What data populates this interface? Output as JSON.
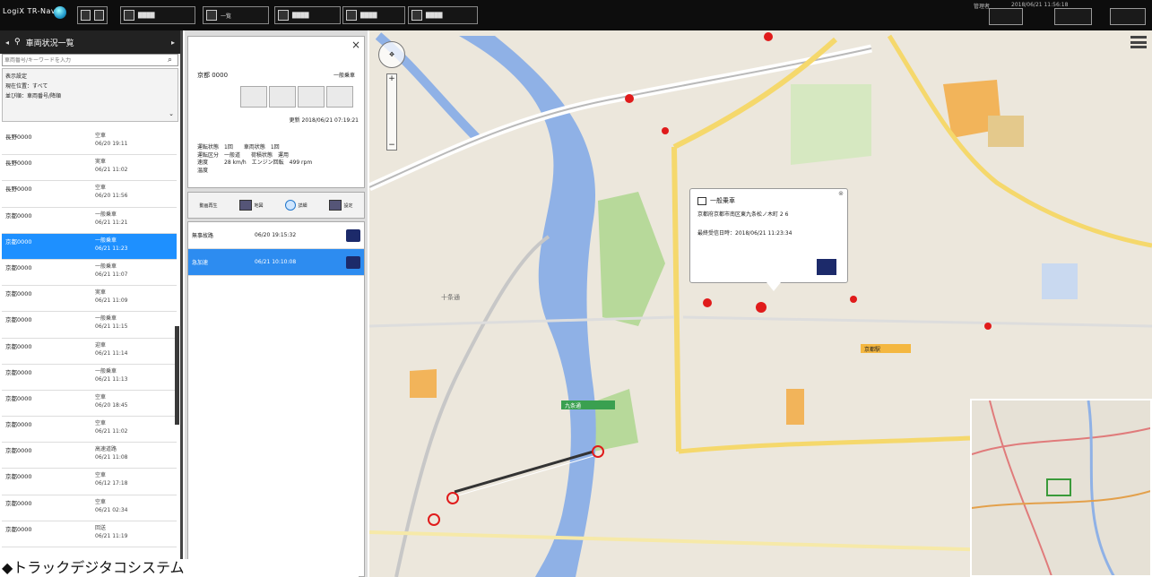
{
  "topbar": {
    "logo": "LogiX TR-Navi",
    "buttons": [
      {
        "name": "tb-button-1",
        "label": "████"
      },
      {
        "name": "tb-button-2",
        "label": "一覧"
      },
      {
        "name": "tb-button-3",
        "label": "████"
      },
      {
        "name": "tb-button-4",
        "label": "████"
      },
      {
        "name": "tb-button-5",
        "label": "████"
      }
    ],
    "right_text": "2018/06/21 11:56:18",
    "right_user": "管理者"
  },
  "left": {
    "title": "車両状況一覧",
    "search_placeholder": "車両番号/キーワードを入力",
    "filter_lines": [
      "表示設定",
      "現在位置：すべて",
      "並び順：車両番号/降順"
    ],
    "vehicles": [
      {
        "name": "長野0000",
        "status": "空車",
        "time": "06/20 19:11"
      },
      {
        "name": "長野0000",
        "status": "実車",
        "time": "06/21 11:02"
      },
      {
        "name": "長野0000",
        "status": "空車",
        "time": "06/20 11:56"
      },
      {
        "name": "京都0000",
        "status": "一般乗車",
        "time": "06/21 11:21"
      },
      {
        "name": "京都0000",
        "status": "一般乗車",
        "time": "06/21 11:23"
      },
      {
        "name": "京都0000",
        "status": "一般乗車",
        "time": "06/21 11:07"
      },
      {
        "name": "京都0000",
        "status": "実車",
        "time": "06/21 11:09"
      },
      {
        "name": "京都0000",
        "status": "一般乗車",
        "time": "06/21 11:15"
      },
      {
        "name": "京都0000",
        "status": "迎車",
        "time": "06/21 11:14"
      },
      {
        "name": "京都0000",
        "status": "一般乗車",
        "time": "06/21 11:13"
      },
      {
        "name": "京都0000",
        "status": "空車",
        "time": "06/20 18:45"
      },
      {
        "name": "京都0000",
        "status": "空車",
        "time": "06/21 11:02"
      },
      {
        "name": "京都0000",
        "status": "高速道路",
        "time": "06/21 11:08"
      },
      {
        "name": "京都0000",
        "status": "空車",
        "time": "06/12 17:18"
      },
      {
        "name": "京都0000",
        "status": "空車",
        "time": "06/21 02:34"
      },
      {
        "name": "京都0000",
        "status": "回送",
        "time": "06/21 11:19"
      }
    ],
    "selected_index": 4
  },
  "caption": "◆トラックデジタコシステム",
  "detail": {
    "name": "京都 0000",
    "state": "一般乗車",
    "updated": "更新 2018/06/21 07:19:21",
    "specs": [
      "運転状態　1回　　車両状態　1回",
      "運転区分　一般道　　荷積状態　運用",
      "速度　　　28 km/h　エンジン回転　499 rpm",
      "温度"
    ],
    "toolbar": [
      "動画再生",
      "地図",
      "詳細",
      "設定"
    ],
    "events": [
      {
        "name": "無事故路",
        "time": "06/20 19:15:32"
      },
      {
        "name": "急加速",
        "time": "06/21 10:10:08"
      }
    ],
    "selected_event": 1
  },
  "popup": {
    "title": "一般乗車",
    "address": "京都府京都市南区東九条松ノ木町 2 6",
    "time": "最終受信日時：2018/06/21 11:23:34"
  },
  "map_labels": {
    "a": "十条通",
    "b": "九条通",
    "c": "京都駅"
  }
}
